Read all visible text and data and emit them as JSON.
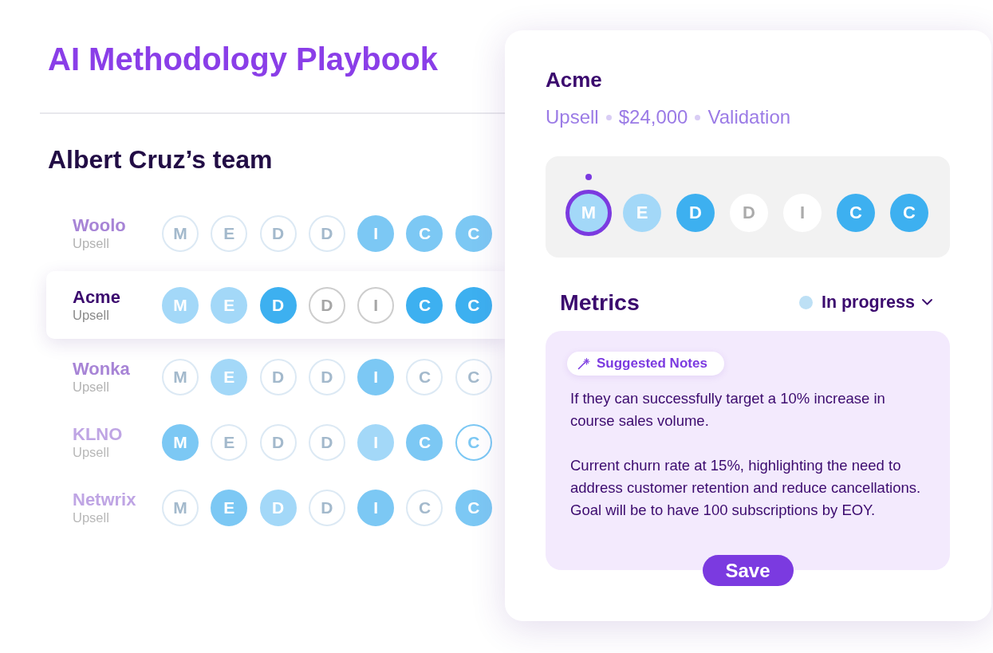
{
  "header": {
    "title": "AI Methodology Playbook"
  },
  "team": {
    "title": "Albert Cruz’s team",
    "accounts": [
      {
        "name": "Woolo",
        "type": "Upsell",
        "selected": false,
        "stages": [
          {
            "letter": "M",
            "kind": "empty"
          },
          {
            "letter": "E",
            "kind": "empty"
          },
          {
            "letter": "D",
            "kind": "empty"
          },
          {
            "letter": "D",
            "kind": "empty"
          },
          {
            "letter": "I",
            "kind": "done"
          },
          {
            "letter": "C",
            "kind": "done"
          },
          {
            "letter": "C",
            "kind": "done"
          }
        ]
      },
      {
        "name": "Acme",
        "type": "Upsell",
        "selected": true,
        "stages": [
          {
            "letter": "M",
            "kind": "partial"
          },
          {
            "letter": "E",
            "kind": "partial"
          },
          {
            "letter": "D",
            "kind": "done"
          },
          {
            "letter": "D",
            "kind": "empty"
          },
          {
            "letter": "I",
            "kind": "empty"
          },
          {
            "letter": "C",
            "kind": "done"
          },
          {
            "letter": "C",
            "kind": "done"
          }
        ]
      },
      {
        "name": "Wonka",
        "type": "Upsell",
        "selected": false,
        "stages": [
          {
            "letter": "M",
            "kind": "empty"
          },
          {
            "letter": "E",
            "kind": "partial"
          },
          {
            "letter": "D",
            "kind": "empty"
          },
          {
            "letter": "D",
            "kind": "empty"
          },
          {
            "letter": "I",
            "kind": "done"
          },
          {
            "letter": "C",
            "kind": "empty"
          },
          {
            "letter": "C",
            "kind": "empty"
          }
        ]
      },
      {
        "name": "KLNO",
        "type": "Upsell",
        "selected": false,
        "stages": [
          {
            "letter": "M",
            "kind": "done"
          },
          {
            "letter": "E",
            "kind": "empty"
          },
          {
            "letter": "D",
            "kind": "empty"
          },
          {
            "letter": "D",
            "kind": "empty"
          },
          {
            "letter": "I",
            "kind": "partial"
          },
          {
            "letter": "C",
            "kind": "done"
          },
          {
            "letter": "C",
            "kind": "current"
          }
        ]
      },
      {
        "name": "Netwrix",
        "type": "Upsell",
        "selected": false,
        "stages": [
          {
            "letter": "M",
            "kind": "empty"
          },
          {
            "letter": "E",
            "kind": "done"
          },
          {
            "letter": "D",
            "kind": "partial"
          },
          {
            "letter": "D",
            "kind": "empty"
          },
          {
            "letter": "I",
            "kind": "done"
          },
          {
            "letter": "C",
            "kind": "empty"
          },
          {
            "letter": "C",
            "kind": "done"
          }
        ]
      }
    ]
  },
  "detail": {
    "title": "Acme",
    "meta": {
      "type": "Upsell",
      "amount": "$24,000",
      "stage": "Validation"
    },
    "stages": [
      {
        "letter": "M",
        "kind": "partial",
        "selected": true
      },
      {
        "letter": "E",
        "kind": "partial",
        "selected": false
      },
      {
        "letter": "D",
        "kind": "done",
        "selected": false
      },
      {
        "letter": "D",
        "kind": "empty",
        "selected": false
      },
      {
        "letter": "I",
        "kind": "empty",
        "selected": false
      },
      {
        "letter": "C",
        "kind": "done",
        "selected": false
      },
      {
        "letter": "C",
        "kind": "done",
        "selected": false
      }
    ],
    "metrics": {
      "title": "Metrics",
      "status": {
        "label": "In progress",
        "color": "#bde0f5"
      },
      "chip": "Suggested Notes",
      "notes": [
        "If they can successfully target a 10% increase in course sales volume.",
        "Current churn rate at 15%, highlighting the need to address customer retention and reduce cancellations. Goal will be to have 100 subscriptions by EOY."
      ],
      "save": "Save"
    }
  }
}
